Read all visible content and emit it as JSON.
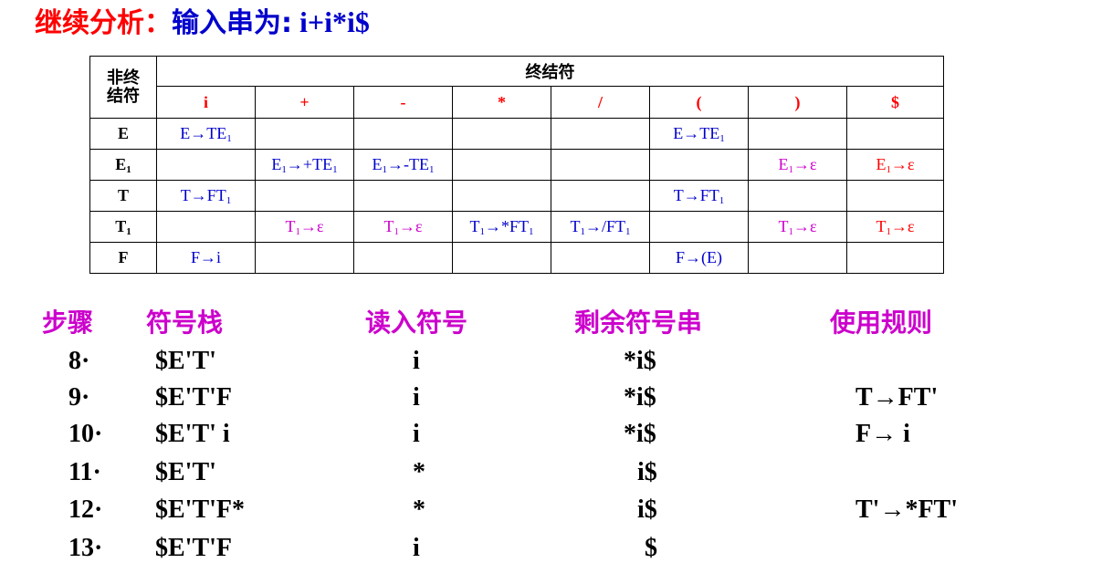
{
  "title": {
    "part1": "继续分析：",
    "part2": "输入串为:",
    "part3": " i+i*i$"
  },
  "table": {
    "corner": {
      "line1": "非终",
      "line2": "结符"
    },
    "terminal_header": "终结符",
    "terminals": [
      "i",
      "+",
      "-",
      "*",
      "/",
      "(",
      ")",
      "$"
    ],
    "rows": [
      {
        "nt": "E",
        "cells": [
          {
            "lhs": "E",
            "sub": "1",
            "rhs": ""
          },
          null,
          null,
          null,
          null,
          null,
          null,
          null
        ]
      },
      {
        "nt": "E1",
        "cells": []
      },
      {
        "nt": "T",
        "cells": []
      },
      {
        "nt": "T1",
        "cells": []
      },
      {
        "nt": "F",
        "cells": []
      }
    ]
  },
  "steps": {
    "headers": {
      "step": "步骤",
      "stack": "符号栈",
      "input": "读入符号",
      "rest": "剩余符号串",
      "rule": "使用规则"
    },
    "rows": [
      {
        "step": "8·",
        "stack": "$E'T'",
        "input": "i",
        "rest": "*i$",
        "rule": ""
      },
      {
        "step": "9·",
        "stack": "$E'T'F",
        "input": "i",
        "rest": "*i$",
        "rule": "T→FT'"
      },
      {
        "step": "10·",
        "stack": "$E'T' i",
        "input": "i",
        "rest": "*i$",
        "rule": "F→ i"
      },
      {
        "step": "11·",
        "stack": "$E'T'",
        "input": "*",
        "rest": "i$",
        "rule": ""
      },
      {
        "step": "12·",
        "stack": "$E'T'F*",
        "input": "*",
        "rest": "i$",
        "rule": "T'→*FT'"
      },
      {
        "step": "13·",
        "stack": "$E'T'F",
        "input": "i",
        "rest": "$",
        "rule": ""
      }
    ]
  }
}
